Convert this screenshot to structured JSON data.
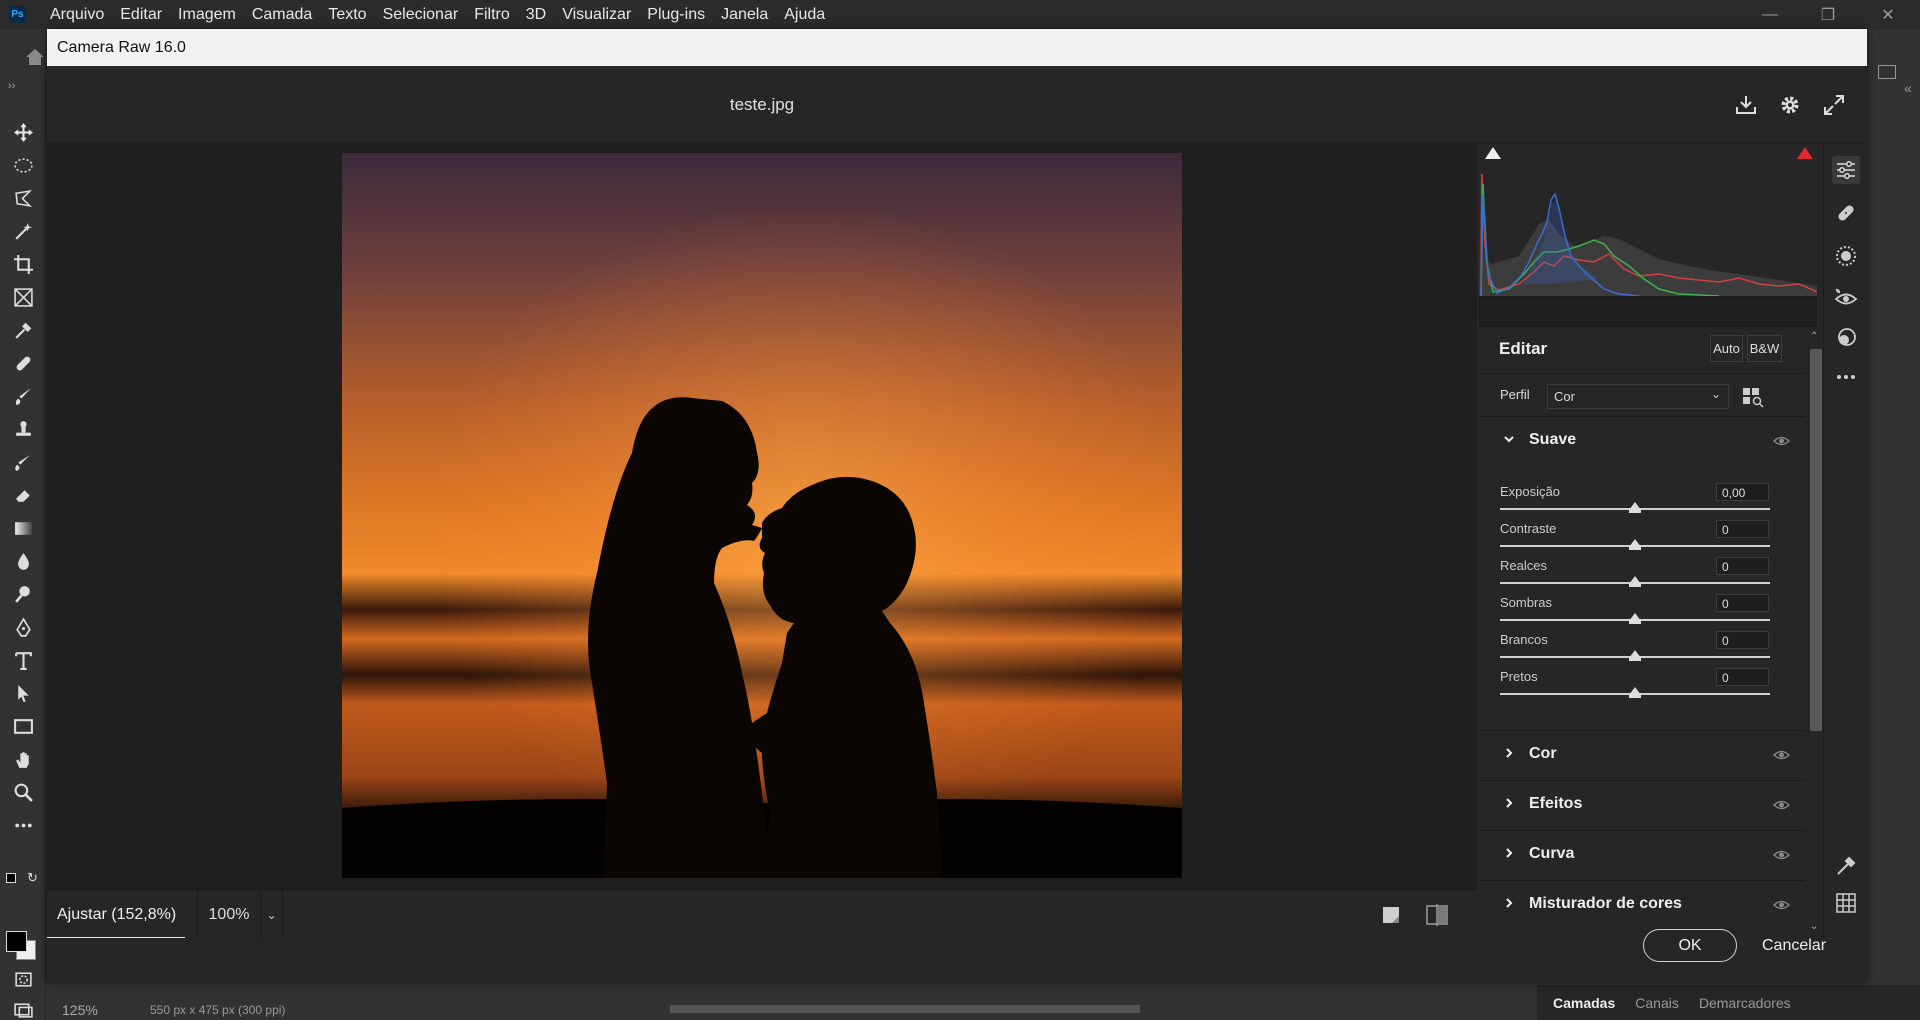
{
  "photoshop": {
    "logo": "Ps",
    "menu": [
      "Arquivo",
      "Editar",
      "Imagem",
      "Camada",
      "Texto",
      "Selecionar",
      "Filtro",
      "3D",
      "Visualizar",
      "Plug-ins",
      "Janela",
      "Ajuda"
    ],
    "status": {
      "zoom": "125%",
      "doc_info": "550 px x 475 px (300 ppi)"
    },
    "layers_tabs": [
      "Camadas",
      "Canais",
      "Demarcadores"
    ]
  },
  "dialog": {
    "title": "Camera Raw 16.0",
    "filename": "teste.jpg",
    "zoom_fit_label": "Ajustar (152,8%)",
    "zoom_percent": "100%",
    "ok_label": "OK",
    "cancel_label": "Cancelar"
  },
  "panel": {
    "title": "Editar",
    "auto_label": "Auto",
    "bw_label": "B&W",
    "profile_label": "Perfil",
    "profile_value": "Cor",
    "basic_section": {
      "title": "Suave",
      "sliders": [
        {
          "label": "Exposição",
          "value": "0,00",
          "position": 0.5
        },
        {
          "label": "Contraste",
          "value": "0",
          "position": 0.5
        },
        {
          "label": "Realces",
          "value": "0",
          "position": 0.5
        },
        {
          "label": "Sombras",
          "value": "0",
          "position": 0.5
        },
        {
          "label": "Brancos",
          "value": "0",
          "position": 0.5
        },
        {
          "label": "Pretos",
          "value": "0",
          "position": 0.5
        }
      ]
    },
    "collapsed_sections": [
      "Cor",
      "Efeitos",
      "Curva",
      "Misturador de cores"
    ]
  },
  "colors": {
    "accent_clipping_warning": "#e0282a",
    "histogram_red": "#d04040",
    "histogram_green": "#3cb04a",
    "histogram_blue": "#3a6cd6"
  }
}
